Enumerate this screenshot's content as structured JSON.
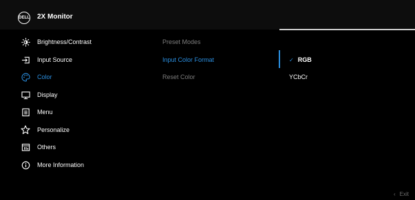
{
  "header": {
    "brand_logo_text": "DELL",
    "title": "2X Monitor"
  },
  "menu": {
    "items": [
      {
        "label": "Brightness/Contrast",
        "icon": "brightness-icon"
      },
      {
        "label": "Input Source",
        "icon": "input-source-icon"
      },
      {
        "label": "Color",
        "icon": "color-palette-icon",
        "active": true
      },
      {
        "label": "Display",
        "icon": "display-icon"
      },
      {
        "label": "Menu",
        "icon": "menu-icon"
      },
      {
        "label": "Personalize",
        "icon": "star-icon"
      },
      {
        "label": "Others",
        "icon": "others-icon"
      },
      {
        "label": "More Information",
        "icon": "info-icon"
      }
    ]
  },
  "submenu": {
    "items": [
      {
        "label": "Preset Modes"
      },
      {
        "label": "Input Color Format",
        "active": true
      },
      {
        "label": "Reset Color"
      }
    ]
  },
  "options": {
    "items": [
      {
        "label": "RGB",
        "selected": true,
        "check": "✓"
      },
      {
        "label": "YCbCr",
        "selected": false
      }
    ]
  },
  "footer": {
    "exit_label": "Exit",
    "back_glyph": "‹"
  },
  "colors": {
    "accent": "#2b8fe0",
    "background": "#000000",
    "inactive_text": "#7d7d7d"
  }
}
